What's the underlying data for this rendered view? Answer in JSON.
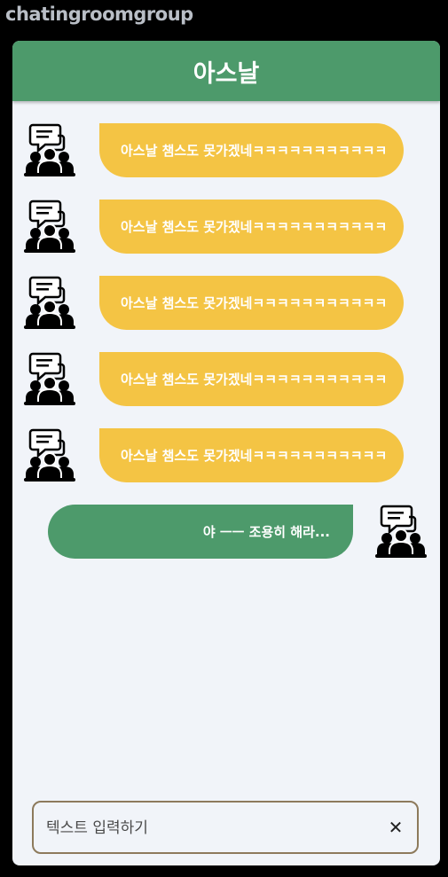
{
  "app": {
    "title": "chatingroomgroup"
  },
  "header": {
    "title": "아스날"
  },
  "messages": [
    {
      "direction": "incoming",
      "text": "아스날 챔스도 못가겠네ㅋㅋㅋㅋㅋㅋㅋㅋㅋㅋㅋ",
      "avatar_icon": "group-chat-icon"
    },
    {
      "direction": "incoming",
      "text": "아스날 챔스도 못가겠네ㅋㅋㅋㅋㅋㅋㅋㅋㅋㅋㅋ",
      "avatar_icon": "group-chat-icon"
    },
    {
      "direction": "incoming",
      "text": "아스날 챔스도 못가겠네ㅋㅋㅋㅋㅋㅋㅋㅋㅋㅋㅋ",
      "avatar_icon": "group-chat-icon"
    },
    {
      "direction": "incoming",
      "text": "아스날 챔스도 못가겠네ㅋㅋㅋㅋㅋㅋㅋㅋㅋㅋㅋ",
      "avatar_icon": "group-chat-icon"
    },
    {
      "direction": "incoming",
      "text": "아스날 챔스도 못가겠네ㅋㅋㅋㅋㅋㅋㅋㅋㅋㅋㅋ",
      "avatar_icon": "group-chat-icon"
    },
    {
      "direction": "outgoing",
      "text": "야 ㅡㅡ 조용히 해라...",
      "avatar_icon": "group-chat-icon"
    }
  ],
  "input": {
    "placeholder": "텍스트 입력하기",
    "clear_icon": "close-icon",
    "clear_glyph": "✕"
  },
  "colors": {
    "header": "#4d9a6b",
    "incoming_bubble": "#f4c444",
    "outgoing_bubble": "#4d9a6b",
    "panel": "#f1f4f9",
    "background": "#000000"
  }
}
